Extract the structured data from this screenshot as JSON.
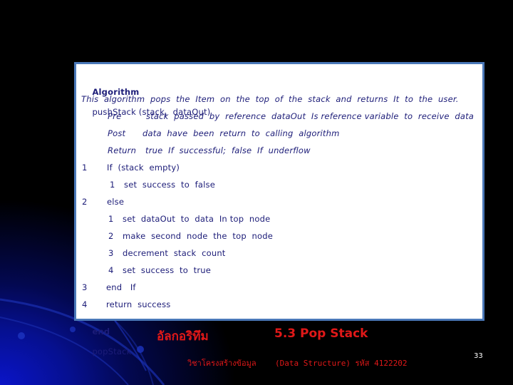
{
  "slide": {
    "header": {
      "keyword": "Algorithm",
      "signature": "pushStack (stack,  dataOut)"
    },
    "description": "This  algorithm  pops  the  Item  on  the  top  of  the  stack  and  returns  It  to  the  user.",
    "conditions": [
      {
        "label": "Pre",
        "text": "stack  passed  by  reference  dataOut  Is reference variable  to  receive  data"
      },
      {
        "label": "Post",
        "text": "data  have  been  return  to  calling  algorithm"
      },
      {
        "label": "Return",
        "text": "true  If  successful;  false  If  underflow"
      }
    ],
    "steps": [
      {
        "num": "1",
        "text": "If  (stack  empty)",
        "level": 0
      },
      {
        "num": "1",
        "text": "set  success  to  false",
        "level": 1
      },
      {
        "num": "2",
        "text": "else",
        "level": 0
      },
      {
        "num": "1",
        "text": "set  dataOut  to  data  In top  node",
        "level": 1
      },
      {
        "num": "2",
        "text": "make  second  node  the  top  node",
        "level": 1
      },
      {
        "num": "3",
        "text": "decrement  stack  count",
        "level": 1
      },
      {
        "num": "4",
        "text": "set  success  to  true",
        "level": 1
      },
      {
        "num": "3",
        "text": "end   If",
        "level": 0
      },
      {
        "num": "4",
        "text": "return  success",
        "level": 0
      }
    ],
    "end": {
      "keyword": "end",
      "name": "popStack"
    }
  },
  "footer": {
    "thai_title": "อัลกอริทึม",
    "section_title": "5.3 Pop Stack",
    "thai_course": "วิชาโครงสร้างข้อมูล",
    "course": "(Data Structure) รหัส   4122202",
    "page_number": "33"
  },
  "colors": {
    "text": "#1c1c78",
    "footer_text": "#e01818",
    "box_border": "#4a78b8",
    "background": "#000000"
  }
}
